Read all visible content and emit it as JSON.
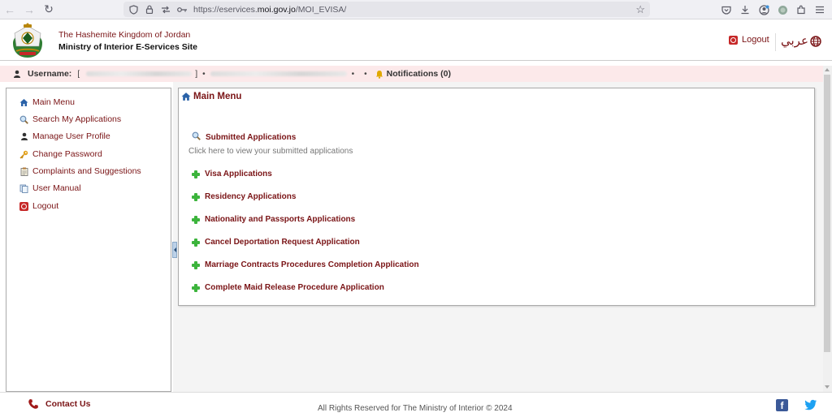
{
  "browser": {
    "url_prefix": "https://eservices.",
    "url_domain": "moi.gov.jo",
    "url_path": "/MOI_EVISA/"
  },
  "header": {
    "org_name": "The Hashemite Kingdom of Jordan",
    "site_name": "Ministry of Interior E-Services Site",
    "logout_label": "Logout",
    "language_label": "عربي"
  },
  "user_bar": {
    "username_label": "Username:",
    "bracket_open": "[",
    "bracket_close": "]",
    "notifications_label": "Notifications (0)"
  },
  "sidebar": {
    "items": [
      {
        "label": "Main Menu",
        "icon": "home-icon"
      },
      {
        "label": "Search My Applications",
        "icon": "search-icon"
      },
      {
        "label": "Manage User Profile",
        "icon": "user-icon"
      },
      {
        "label": "Change Password",
        "icon": "key-icon"
      },
      {
        "label": "Complaints and Suggestions",
        "icon": "document-icon"
      },
      {
        "label": "User Manual",
        "icon": "manual-icon"
      },
      {
        "label": "Logout",
        "icon": "logout-icon"
      }
    ]
  },
  "main": {
    "title": "Main Menu",
    "submitted": {
      "label": "Submitted Applications",
      "description": "Click here to view your submitted applications"
    },
    "applications": [
      {
        "label": "Visa Applications"
      },
      {
        "label": "Residency Applications"
      },
      {
        "label": "Nationality and Passports Applications"
      },
      {
        "label": "Cancel Deportation Request Application"
      },
      {
        "label": "Marriage Contracts Procedures Completion Application"
      },
      {
        "label": "Complete Maid Release Procedure Application"
      }
    ]
  },
  "footer": {
    "contact_label": "Contact Us",
    "copyright": "All Rights Reserved for The Ministry of Interior © 2024"
  },
  "colors": {
    "brand": "#7a1416",
    "user_strip_bg": "#fce9ea",
    "plus_green": "#3cb43c"
  }
}
